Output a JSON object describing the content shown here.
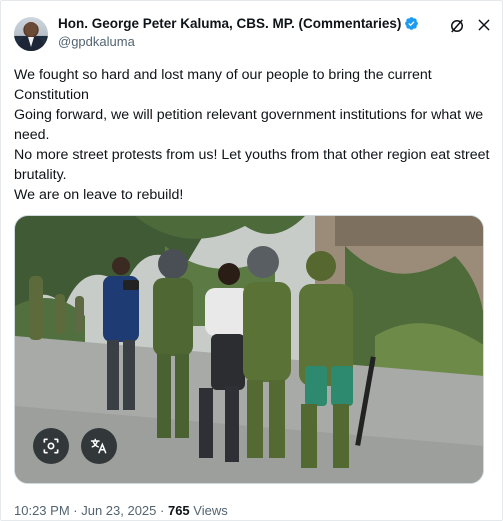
{
  "author": {
    "display_name": "Hon. George Peter Kaluma, CBS. MP. (Commentaries)",
    "handle": "@gpdkaluma",
    "verified": true,
    "verified_color": "#1d9bf0"
  },
  "tweet": {
    "lines": [
      "We fought so hard and lost many of our people to bring the current Constitution",
      "Going forward, we will petition relevant government institutions for what we need.",
      "No more street protests from us! Let youths from that other region eat street brutality.",
      "We are on leave to rebuild!"
    ]
  },
  "media": {
    "icons": [
      "lens-icon",
      "translate-icon"
    ]
  },
  "meta": {
    "time": "10:23 PM",
    "separator1": " · ",
    "date": "Jun 23, 2025",
    "separator2": " · ",
    "views_count": "765",
    "views_label": " Views"
  },
  "header_icons": [
    "grok-icon",
    "close-icon"
  ]
}
